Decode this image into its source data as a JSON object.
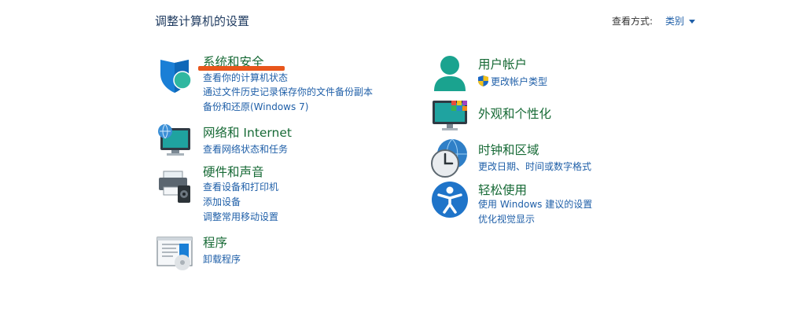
{
  "header": {
    "title": "调整计算机的设置",
    "view_by_label": "查看方式:",
    "view_by_value": "类别"
  },
  "left_categories": [
    {
      "title": "系统和安全",
      "icon": "shield-icon",
      "links": [
        "查看你的计算机状态",
        "通过文件历史记录保存你的文件备份副本",
        "备份和还原(Windows 7)"
      ]
    },
    {
      "title": "网络和 Internet",
      "icon": "network-globe-icon",
      "links": [
        "查看网络状态和任务"
      ]
    },
    {
      "title": "硬件和声音",
      "icon": "printer-speaker-icon",
      "links": [
        "查看设备和打印机",
        "添加设备",
        "调整常用移动设置"
      ]
    },
    {
      "title": "程序",
      "icon": "programs-icon",
      "links": [
        "卸载程序"
      ]
    }
  ],
  "right_categories": [
    {
      "title": "用户帐户",
      "icon": "user-icon",
      "links": [
        "更改帐户类型"
      ]
    },
    {
      "title": "外观和个性化",
      "icon": "monitor-colors-icon",
      "links": []
    },
    {
      "title": "时钟和区域",
      "icon": "clock-globe-icon",
      "links": [
        "更改日期、时间或数字格式"
      ]
    },
    {
      "title": "轻松使用",
      "icon": "accessibility-icon",
      "links": [
        "使用 Windows 建议的设置",
        "优化视觉显示"
      ]
    }
  ],
  "colors": {
    "title_green": "#176a36",
    "link_blue": "#1f5fa8",
    "annotation_orange": "#e8561c"
  }
}
